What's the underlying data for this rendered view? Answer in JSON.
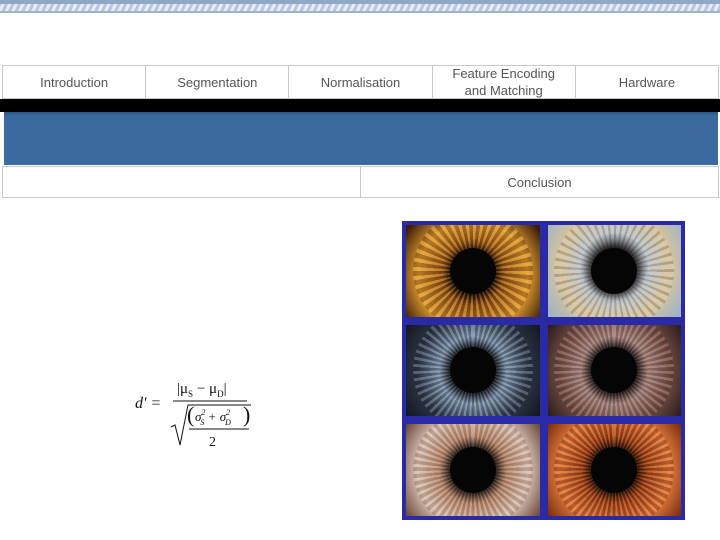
{
  "nav": {
    "items": [
      {
        "label": "Introduction"
      },
      {
        "label": "Segmentation"
      },
      {
        "label": "Normalisation"
      },
      {
        "label": "Feature Encoding and Matching"
      },
      {
        "label": "Hardware"
      }
    ]
  },
  "subnav": {
    "left_label": "",
    "right_label": "Conclusion"
  },
  "formula": {
    "lhs": "d' =",
    "numerator": "|μS − μD|",
    "denominator_terms": "σS² + σD²",
    "divisor": "2"
  },
  "gallery": {
    "frame_color": "#2b2aa6",
    "images": [
      {
        "icon": "iris-amber-image"
      },
      {
        "icon": "iris-grey-blue-image"
      },
      {
        "icon": "iris-dark-blue-image"
      },
      {
        "icon": "iris-brown-image"
      },
      {
        "icon": "iris-light-brown-image"
      },
      {
        "icon": "iris-orange-image"
      }
    ]
  },
  "colors": {
    "blue_band": "#3a6aa0",
    "nav_text": "#555555"
  }
}
